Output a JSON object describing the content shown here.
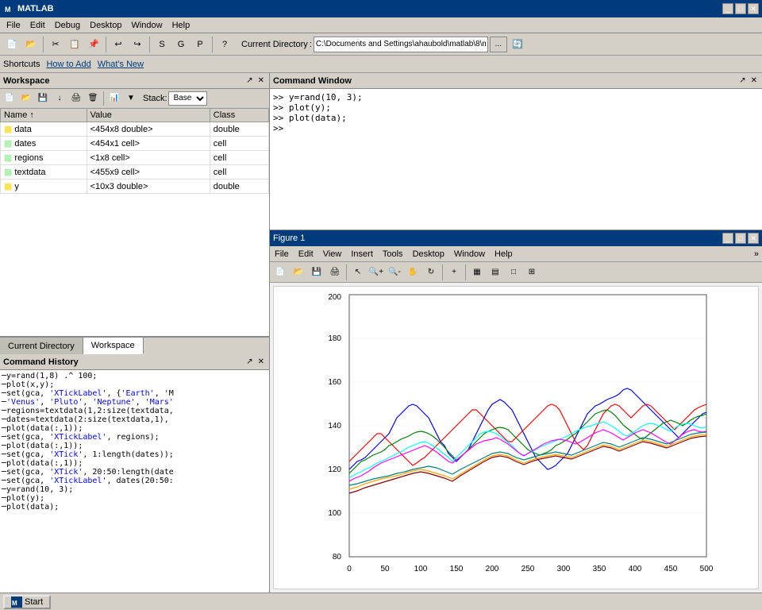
{
  "app": {
    "title": "MATLAB",
    "current_directory": "C:\\Documents and Settings\\ahaubold\\matlab\\8\\m"
  },
  "menu": {
    "items": [
      "File",
      "Edit",
      "Debug",
      "Desktop",
      "Window",
      "Help"
    ]
  },
  "shortcuts_bar": {
    "shortcuts": "Shortcuts",
    "how_to_add": "How to Add",
    "whats_new": "What's New"
  },
  "workspace": {
    "title": "Workspace",
    "columns": [
      "Name",
      "Value",
      "Class"
    ],
    "stack_label": "Stack:",
    "stack_value": "Base",
    "variables": [
      {
        "name": "data",
        "value": "<454x8 double>",
        "class": "double",
        "type": "matrix"
      },
      {
        "name": "dates",
        "value": "<454x1 cell>",
        "class": "cell",
        "type": "cell"
      },
      {
        "name": "regions",
        "value": "<1x8 cell>",
        "class": "cell",
        "type": "cell"
      },
      {
        "name": "textdata",
        "value": "<455x9 cell>",
        "class": "cell",
        "type": "cell"
      },
      {
        "name": "y",
        "value": "<10x3 double>",
        "class": "double",
        "type": "matrix"
      }
    ]
  },
  "tabs": {
    "current_directory": "Current Directory",
    "workspace": "Workspace"
  },
  "command_history": {
    "title": "Command History",
    "lines": [
      "y=rand(1,8) .^ 100;",
      "plot(x,y);",
      "set(gca, 'XTickLabel', {'Earth', 'M",
      "'Venus', 'Pluto', 'Neptune', 'Mars'",
      "regions=textdata(1,2:size(textdata,",
      "dates=textdata(2:size(textdata,1),",
      "plot(data(:,1));",
      "set(gca, 'XTickLabel', regions);",
      "plot(data(:,1));",
      "set(gca, 'XTick', 1:length(dates));",
      "plot(data(:,1));",
      "set(gca, 'XTick', 20:50:length(date",
      "set(gca, 'XTickLabel', dates(20:50:",
      "y=rand(10, 3);",
      "plot(y);",
      "plot(data);"
    ]
  },
  "command_window": {
    "title": "Command Window",
    "lines": [
      ">> y=rand(10, 3);",
      ">> plot(y);",
      ">> plot(data);",
      ">>"
    ]
  },
  "figure": {
    "title": "Figure 1",
    "menu_items": [
      "File",
      "Edit",
      "View",
      "Insert",
      "Tools",
      "Desktop",
      "Window",
      "Help"
    ],
    "plot": {
      "y_min": 80,
      "y_max": 200,
      "x_min": 0,
      "x_max": 500,
      "y_ticks": [
        80,
        100,
        120,
        140,
        160,
        180,
        200
      ],
      "x_ticks": [
        0,
        50,
        100,
        150,
        200,
        250,
        300,
        350,
        400,
        450,
        500
      ]
    }
  },
  "status_bar": {
    "start_label": "Start"
  }
}
